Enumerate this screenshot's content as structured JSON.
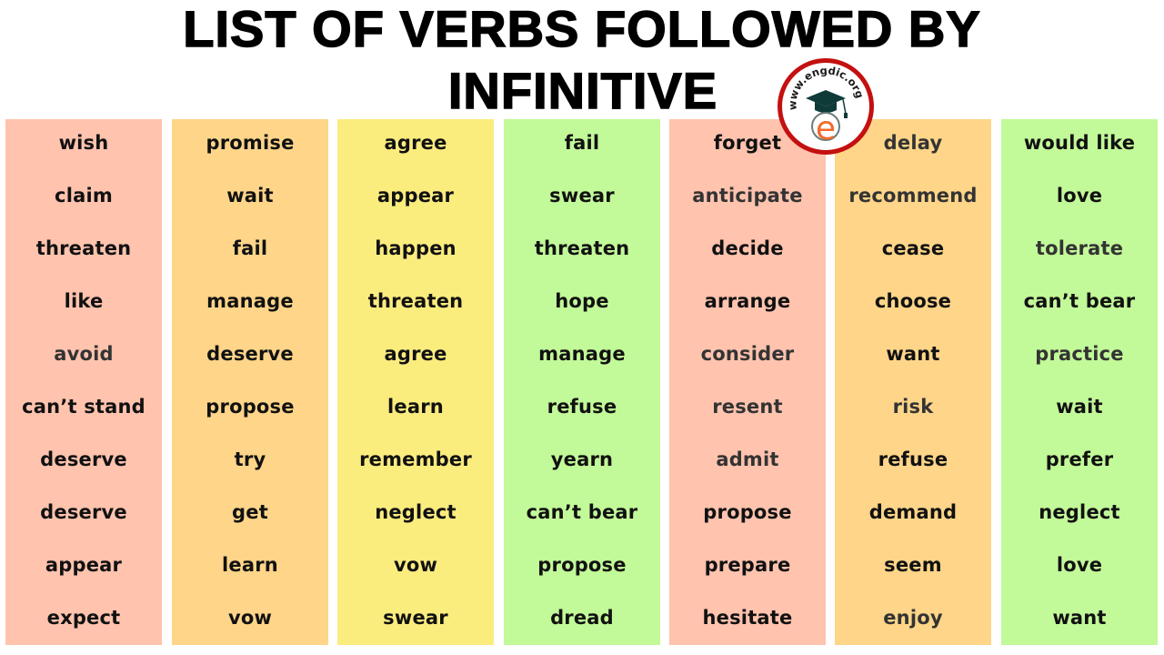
{
  "title": {
    "line1": "LIST OF VERBS FOLLOWED BY",
    "line2": "INFINITIVE"
  },
  "logo": {
    "text": "www.engdic.org",
    "icon": "graduation-cap-icon",
    "letter": "e",
    "ring_color": "#c41010",
    "cap_color": "#0e3b37",
    "letter_color": "#f26b2a"
  },
  "colors": {
    "salmon": "#FFC3AE",
    "orange": "#FED589",
    "yellow": "#FBEC7E",
    "green": "#C2F999"
  },
  "columns": [
    {
      "color": "salmon",
      "words": [
        "wish",
        "claim",
        "threaten",
        "like",
        "avoid",
        "can’t stand",
        "deserve",
        "deserve",
        "appear",
        "expect"
      ]
    },
    {
      "color": "orange",
      "words": [
        "promise",
        "wait",
        "fail",
        "manage",
        "deserve",
        "propose",
        "try",
        "get",
        "learn",
        "vow"
      ]
    },
    {
      "color": "yellow",
      "words": [
        "agree",
        "appear",
        "happen",
        "threaten",
        "agree",
        "learn",
        "remember",
        "neglect",
        "vow",
        "swear"
      ]
    },
    {
      "color": "green",
      "words": [
        "fail",
        "swear",
        "threaten",
        "hope",
        "manage",
        "refuse",
        "yearn",
        "can’t bear",
        "propose",
        "dread"
      ]
    },
    {
      "color": "salmon",
      "words": [
        "forget",
        "anticipate",
        "decide",
        "arrange",
        "consider",
        "resent",
        "admit",
        "propose",
        "prepare",
        "hesitate"
      ]
    },
    {
      "color": "orange",
      "words": [
        "delay",
        "recommend",
        "cease",
        "choose",
        "want",
        "risk",
        "refuse",
        "demand",
        "seem",
        "enjoy"
      ]
    },
    {
      "color": "green",
      "words": [
        "would like",
        "love",
        "tolerate",
        "can’t bear",
        "practice",
        "wait",
        "prefer",
        "neglect",
        "love",
        "want"
      ]
    }
  ]
}
